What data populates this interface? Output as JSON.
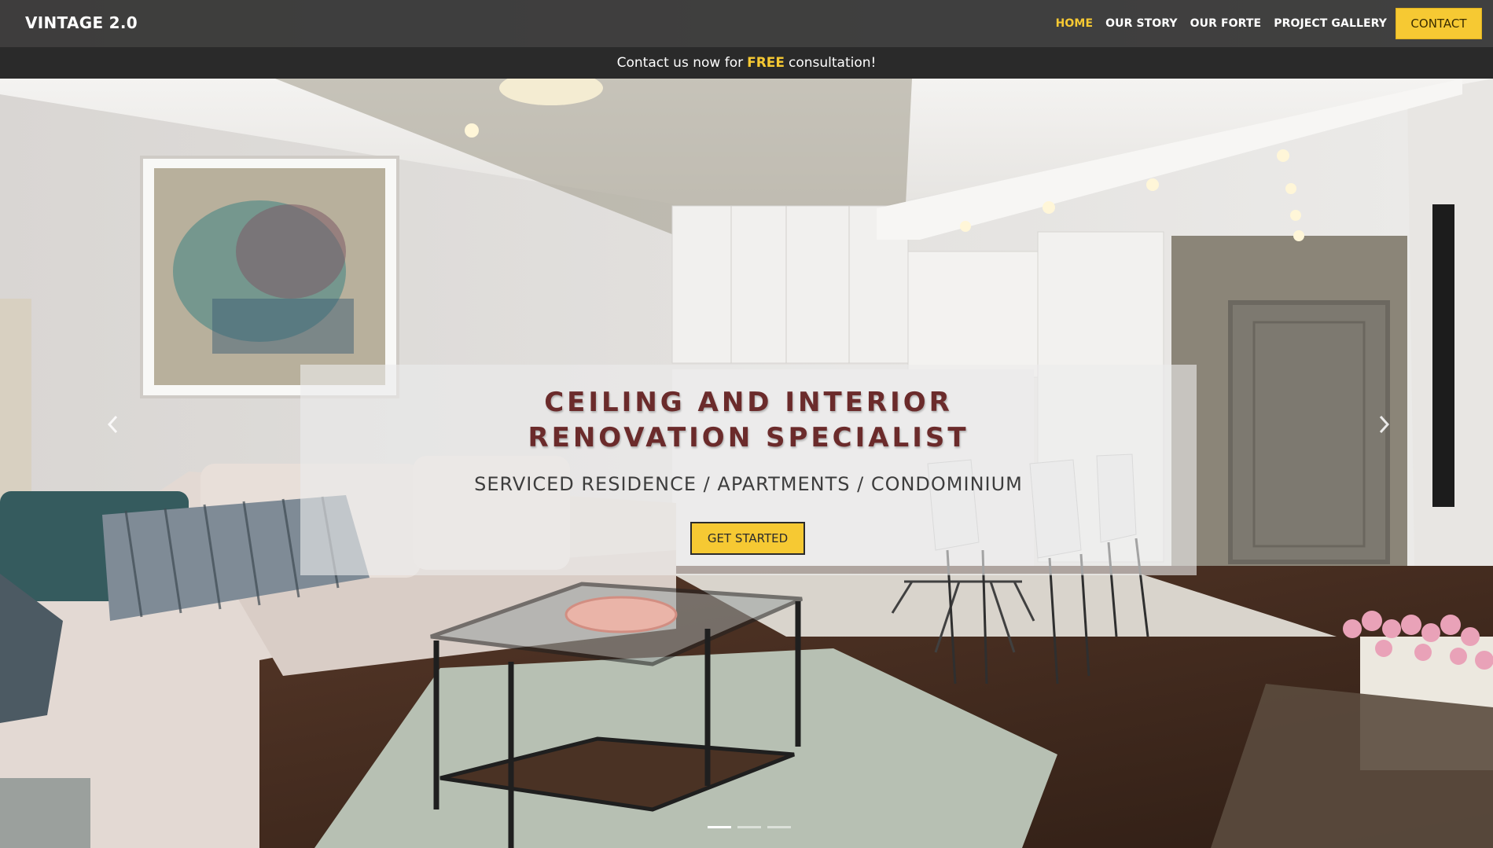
{
  "brand": "VINTAGE 2.0",
  "nav": {
    "items": [
      {
        "label": "HOME",
        "active": true
      },
      {
        "label": "OUR STORY",
        "active": false
      },
      {
        "label": "OUR FORTE",
        "active": false
      },
      {
        "label": "PROJECT GALLERY",
        "active": false
      }
    ],
    "contact_label": "CONTACT"
  },
  "promo": {
    "before": "Contact us now for",
    "highlight": "FREE",
    "after": "consultation!"
  },
  "hero": {
    "title_line1": "CEILING AND INTERIOR",
    "title_line2": "RENOVATION SPECIALIST",
    "subtitle": "SERVICED RESIDENCE / APARTMENTS / CONDOMINIUM",
    "cta_label": "GET STARTED"
  },
  "carousel": {
    "prev_icon": "chevron-left-icon",
    "next_icon": "chevron-right-icon",
    "slide_count": 3,
    "active_slide": 1
  },
  "colors": {
    "accent": "#f6c933",
    "title": "#6b2b2b",
    "navbar": "#282828"
  }
}
